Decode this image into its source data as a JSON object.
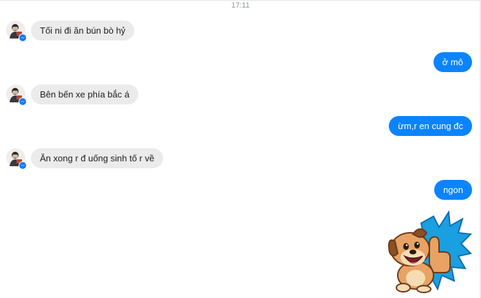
{
  "conversation": {
    "timestamp": "17:11",
    "messages": [
      {
        "from": "contact",
        "text": "Tối ni đi ăn bún bò hỷ"
      },
      {
        "from": "me",
        "text": "ở mô"
      },
      {
        "from": "contact",
        "text": "Bên bến xe phía bắc á"
      },
      {
        "from": "me",
        "text": "ừm,r en cung đc"
      },
      {
        "from": "contact",
        "text": "Ăn xong r đ uống sinh tố r về"
      },
      {
        "from": "me",
        "text": "ngon"
      },
      {
        "from": "me",
        "type": "sticker",
        "sticker": "thumbs-up-puppy"
      }
    ]
  },
  "colors": {
    "outgoing_bubble": "#0b84fe",
    "incoming_bubble": "#ebebeb",
    "messenger_badge": "#0a7cff"
  }
}
